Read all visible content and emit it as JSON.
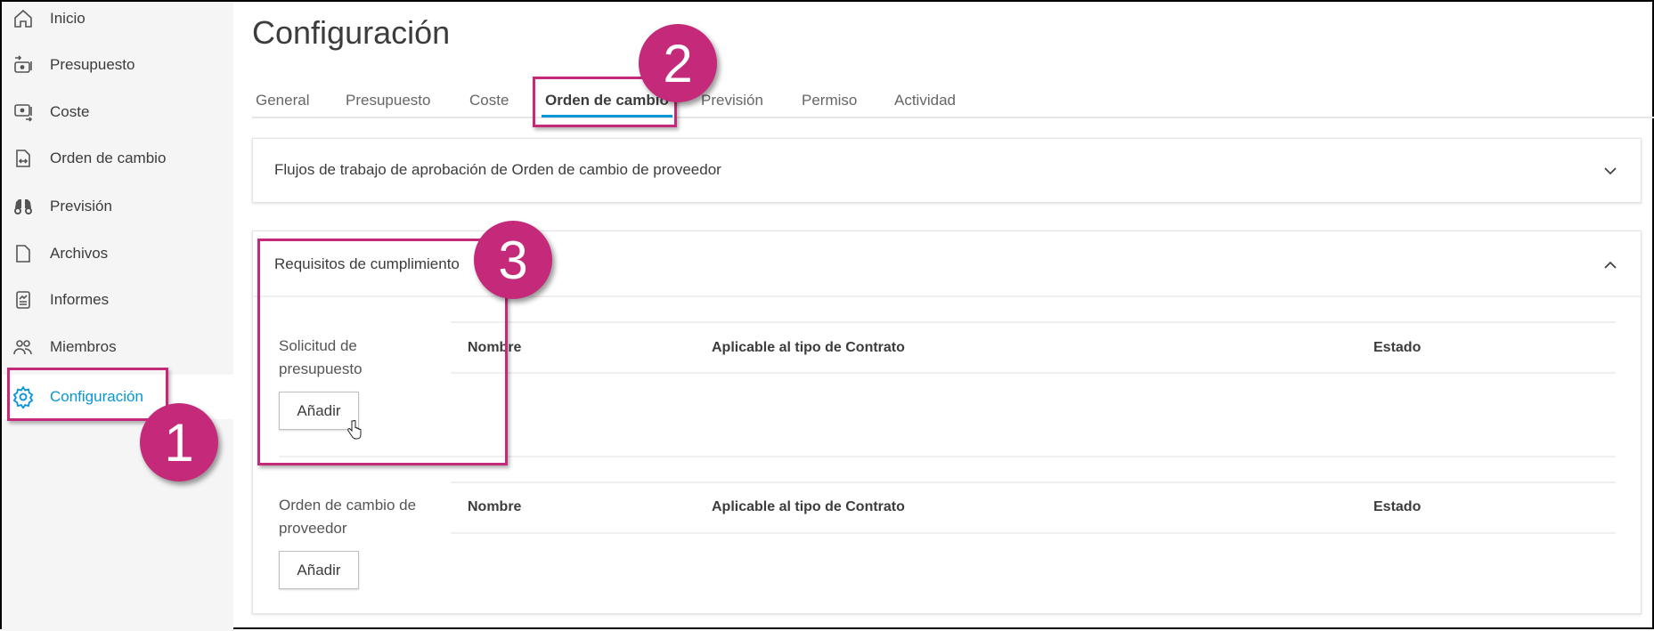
{
  "sidebar": {
    "items": [
      {
        "label": "Inicio",
        "icon": "home-icon"
      },
      {
        "label": "Presupuesto",
        "icon": "budget-icon"
      },
      {
        "label": "Coste",
        "icon": "cost-icon"
      },
      {
        "label": "Orden de cambio",
        "icon": "change-order-icon"
      },
      {
        "label": "Previsión",
        "icon": "binoculars-icon"
      },
      {
        "label": "Archivos",
        "icon": "file-icon"
      },
      {
        "label": "Informes",
        "icon": "report-icon"
      },
      {
        "label": "Miembros",
        "icon": "members-icon"
      },
      {
        "label": "Configuración",
        "icon": "gear-icon",
        "active": true
      }
    ]
  },
  "page": {
    "title": "Configuración"
  },
  "tabs": [
    "General",
    "Presupuesto",
    "Coste",
    "Orden de cambio",
    "Previsión",
    "Permiso",
    "Actividad"
  ],
  "active_tab": "Orden de cambio",
  "sections": {
    "approval": {
      "title": "Flujos de trabajo de aprobación de Orden de cambio de proveedor"
    },
    "compliance": {
      "title": "Requisitos de cumplimiento",
      "groups": [
        {
          "label": "Solicitud de presupuesto",
          "columns": [
            "Nombre",
            "Aplicable al tipo de Contrato",
            "Estado"
          ],
          "button": "Añadir"
        },
        {
          "label": "Orden de cambio de proveedor",
          "columns": [
            "Nombre",
            "Aplicable al tipo de Contrato",
            "Estado"
          ],
          "button": "Añadir"
        }
      ]
    }
  },
  "annotations": [
    "1",
    "2",
    "3"
  ],
  "colors": {
    "accent": "#0696d7",
    "annotation": "#c4297a"
  }
}
